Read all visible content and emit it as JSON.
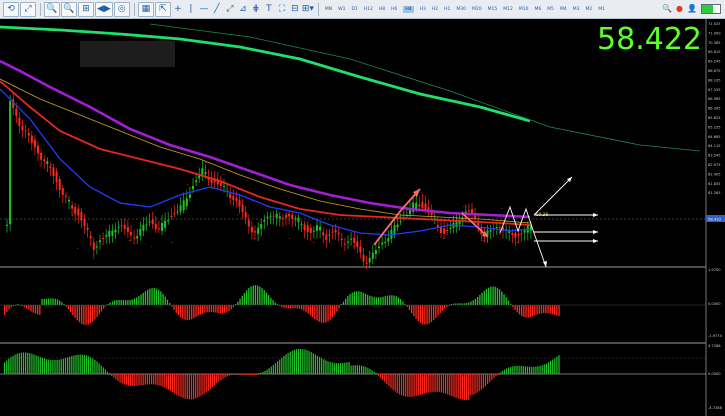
{
  "toolbar": {
    "timeframes": [
      "MN",
      "W1",
      "D1",
      "H12",
      "H8",
      "H6",
      "H4",
      "H3",
      "H2",
      "H1",
      "M30",
      "M20",
      "M15",
      "M12",
      "M10",
      "M6",
      "M5",
      "M4",
      "M3",
      "M2",
      "M1"
    ],
    "active_timeframe": "H4",
    "tool_glyphs": [
      "⟲",
      "⤢",
      "🔍",
      "🔍",
      "⊞",
      "◀▶",
      "◎",
      "▦",
      "⇱",
      "+",
      "|",
      "—",
      "╱",
      "⤢",
      "⊿",
      "⋕",
      "T",
      "⛶",
      "⊟",
      "⊞▾"
    ]
  },
  "price_display": "58.422",
  "price_axis": {
    "labels": [
      "71.525",
      "71.000",
      "70.385",
      "69.815",
      "69.245",
      "68.675",
      "68.105",
      "67.535",
      "66.965",
      "66.395",
      "65.825",
      "65.255",
      "64.685",
      "64.115",
      "63.545",
      "62.975",
      "62.405",
      "61.835",
      "61.265"
    ],
    "current_tag": "58.422",
    "macd_labels": [
      "1.9700",
      "0.0000",
      "-1.9774"
    ],
    "osc_labels": [
      "4.7288",
      "0.0000",
      "-4.7288"
    ]
  },
  "annotation": {
    "level_tag": "59.38"
  },
  "colors": {
    "bull": "#22c32a",
    "bear": "#ff2a1f",
    "ma_green": "#1fe06a",
    "ma_purple": "#a21fd6",
    "ma_red": "#e8261f",
    "ma_blue": "#1f3cff",
    "price_big": "#5cff2a"
  }
}
